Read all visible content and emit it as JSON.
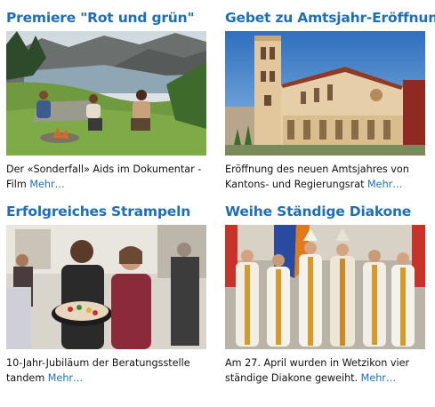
{
  "articles": [
    {
      "title": "Premiere \"Rot und grün\"",
      "teaser": "Der «Sonderfall» Aids im Dokumentar -Film",
      "more": "Mehr…"
    },
    {
      "title": "Gebet zu Amtsjahr-Eröffnung",
      "teaser": "Eröffnung des neuen Amtsjahres von Kantons- und Regierungsrat",
      "more": "Mehr…"
    },
    {
      "title": "Erfolgreiches Strampeln",
      "teaser": "10-Jahr-Jubiläum der Beratungsstelle tandem",
      "more": "Mehr…"
    },
    {
      "title": "Weihe Ständige Diakone",
      "teaser": "Am 27. April wurden in Wetzikon vier ständige Diakone geweiht.",
      "more": "Mehr…"
    }
  ],
  "colors": {
    "link": "#1f6fb2",
    "text": "#111111"
  }
}
